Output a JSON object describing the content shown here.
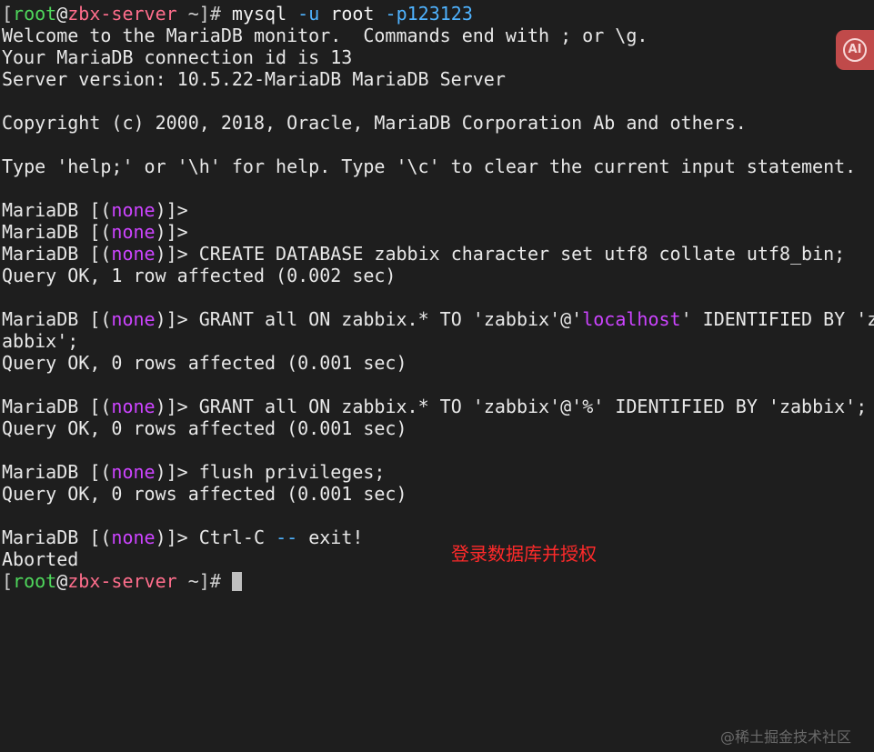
{
  "terminal": {
    "prompt_user": "root",
    "prompt_host": "zbx-server",
    "prompt_dir": "~",
    "initial_command": "mysql",
    "initial_args_user_opt": "-u",
    "initial_args_user": "root",
    "initial_args_pass_opt": "-p123123",
    "welcome_lines": [
      "Welcome to the MariaDB monitor.  Commands end with ; or \\g.",
      "Your MariaDB connection id is 13",
      "Server version: 10.5.22-MariaDB MariaDB Server",
      "",
      "Copyright (c) 2000, 2018, Oracle, MariaDB Corporation Ab and others.",
      "",
      "Type 'help;' or '\\h' for help. Type '\\c' to clear the current input statement."
    ],
    "mariadb_prompt_prefix": "MariaDB [(",
    "mariadb_prompt_db": "none",
    "mariadb_prompt_suffix": ")]>",
    "commands": {
      "create_db": "CREATE DATABASE zabbix character set utf8 collate utf8_bin;",
      "create_db_result": "Query OK, 1 row affected (0.002 sec)",
      "grant_local_pre": "GRANT all ON zabbix.* TO 'zabbix'@'",
      "grant_local_host": "localhost",
      "grant_local_post": "' IDENTIFIED BY 'z",
      "grant_local_wrap": "abbix';",
      "grant_local_result": "Query OK, 0 rows affected (0.001 sec)",
      "grant_any": "GRANT all ON zabbix.* TO 'zabbix'@'%' IDENTIFIED BY 'zabbix';",
      "grant_any_result": "Query OK, 0 rows affected (0.001 sec)",
      "flush": "flush privileges;",
      "flush_result": "Query OK, 0 rows affected (0.001 sec)",
      "exit_ctrl": "Ctrl-C",
      "exit_dashes": "--",
      "exit_text": "exit!",
      "aborted": "Aborted"
    }
  },
  "annotation": "登录数据库并授权",
  "ai_badge": "AI",
  "watermark": "@稀土掘金技术社区",
  "colors": {
    "background": "#1e1e1e",
    "prompt_user": "#4fd85c",
    "prompt_host": "#ff6e8c",
    "option": "#4fb3ff",
    "keyword": "#cc44ff",
    "annotation": "#ff2a2a",
    "ai_badge": "#c04a4a"
  }
}
